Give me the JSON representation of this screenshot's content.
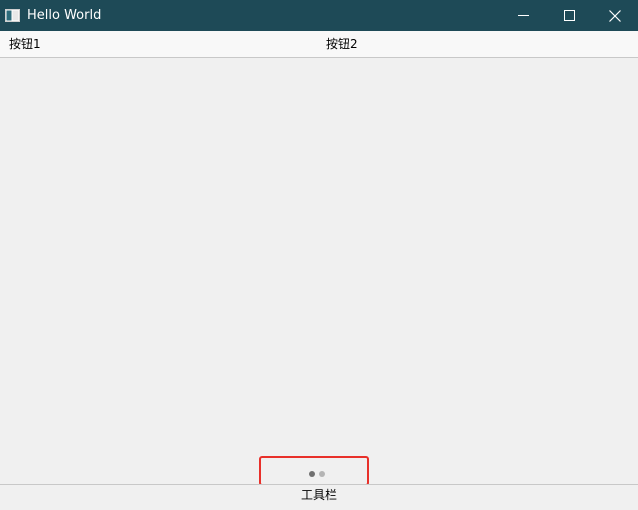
{
  "window": {
    "title": "Hello World",
    "titlebar_color": "#1e4a57",
    "app_icon": "window-app-icon",
    "controls": {
      "minimize_icon": "minimize-icon",
      "maximize_icon": "maximize-icon",
      "close_icon": "close-icon"
    }
  },
  "toolbar": {
    "buttons": [
      {
        "label": "按钮1"
      },
      {
        "label": "按钮2"
      }
    ]
  },
  "page_indicator": {
    "pages": 2,
    "active_index": 0,
    "active_color": "#707070",
    "inactive_color": "#b4b4b4",
    "highlight_color": "#e8302a"
  },
  "bottom_toolbar": {
    "label": "工具栏"
  }
}
